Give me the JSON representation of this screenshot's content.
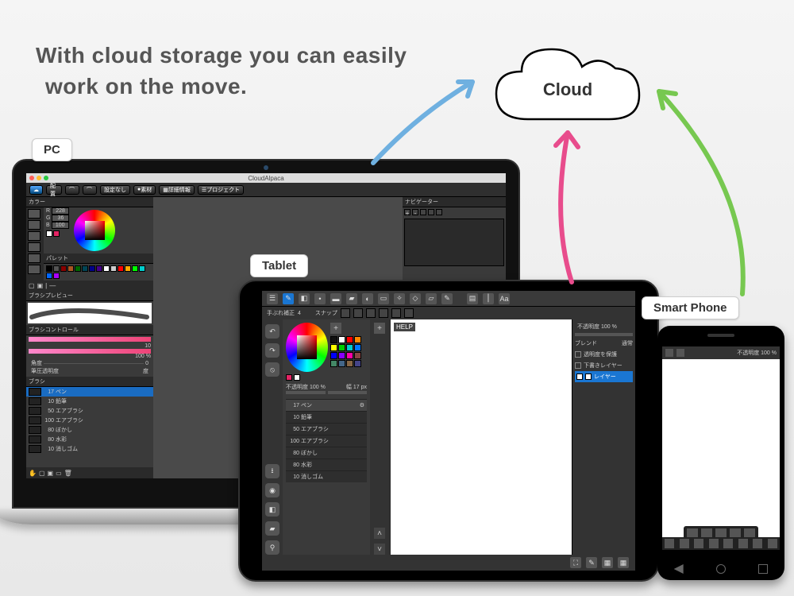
{
  "headline": {
    "line1": "With cloud storage you can easily",
    "line2": "work on the move."
  },
  "cloud_label": "Cloud",
  "labels": {
    "pc": "PC",
    "tablet": "Tablet",
    "phone": "Smart Phone"
  },
  "laptop": {
    "title": "CloudAlpaca",
    "toolbar": {
      "haichi": "配置",
      "correction": "設定なし",
      "sozai": "素材",
      "sansho": "詳細情報",
      "project": "プロジェクト"
    },
    "color_panel": "カラー",
    "rgb": {
      "r_label": "R",
      "r": "228",
      "g_label": "G",
      "g": "36",
      "b_label": "B",
      "b": "100"
    },
    "palette_label": "パレット",
    "brush_preview": "ブラシプレビュー",
    "brush_control": "ブラシコントロール",
    "bc_val1": "10",
    "bc_val2": "100 %",
    "angle_label": "角度",
    "angle_val": "0",
    "opac_pen_label": "筆圧透明度",
    "opac_pen_val": "度",
    "brush_panel": "ブラシ",
    "brush_list": [
      {
        "size": "17",
        "name": "ペン"
      },
      {
        "size": "10",
        "name": "鉛筆"
      },
      {
        "size": "50",
        "name": "エアブラシ"
      },
      {
        "size": "100",
        "name": "エアブラシ"
      },
      {
        "size": "80",
        "name": "ぼかし"
      },
      {
        "size": "80",
        "name": "水彩"
      },
      {
        "size": "10",
        "name": "消しゴム"
      }
    ],
    "navigator": "ナビゲーター"
  },
  "tablet": {
    "correction": {
      "label": "手ぶれ補正",
      "val": "4"
    },
    "snap_label": "スナップ",
    "help": "HELP",
    "opacity": {
      "label": "不透明度",
      "val": "100 %"
    },
    "brush_width": {
      "label": "幅",
      "val": "17 px"
    },
    "brush_list": [
      {
        "size": "17",
        "name": "ペン"
      },
      {
        "size": "10",
        "name": "鉛筆"
      },
      {
        "size": "50",
        "name": "エアブラシ"
      },
      {
        "size": "100",
        "name": "エアブラシ"
      },
      {
        "size": "80",
        "name": "ぼかし"
      },
      {
        "size": "80",
        "name": "水彩"
      },
      {
        "size": "10",
        "name": "消しゴム"
      }
    ],
    "layer": {
      "opacity_label": "不透明度 100 %",
      "blend_label": "ブレンド",
      "blend_val": "通常",
      "protect": "透明度を保護",
      "draft": "下書きレイヤー",
      "layer_name": "レイヤー"
    }
  },
  "phone": {
    "opacity_label": "不透明度 100 %"
  },
  "colors": {
    "mac_red": "#ff5f57",
    "mac_yel": "#febc2e",
    "mac_grn": "#28c840",
    "arrow_blue": "#6fb0e0",
    "arrow_pink": "#e84c8c",
    "arrow_green": "#77c850"
  },
  "palette": [
    "#000",
    "#555",
    "#800",
    "#a52",
    "#060",
    "#045",
    "#008",
    "#408",
    "#fff",
    "#ccc",
    "#f00",
    "#fa0",
    "#0f0",
    "#0cc",
    "#06f",
    "#a0f"
  ],
  "tab_palette": [
    "#111",
    "#fff",
    "#f00",
    "#f80",
    "#ff0",
    "#0c0",
    "#0cc",
    "#07f",
    "#00f",
    "#80f",
    "#f0a",
    "#844",
    "#486",
    "#468",
    "#864",
    "#448"
  ]
}
